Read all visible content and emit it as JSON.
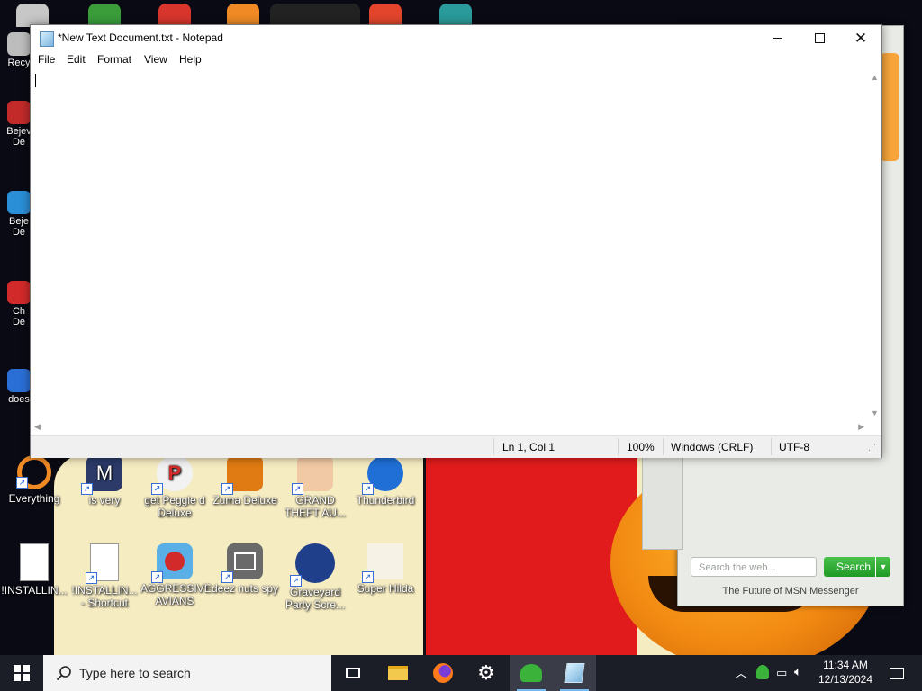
{
  "notepad": {
    "title": "*New Text Document.txt - Notepad",
    "menu": [
      "File",
      "Edit",
      "Format",
      "View",
      "Help"
    ],
    "content": "",
    "status": {
      "position": "Ln 1, Col 1",
      "zoom": "100%",
      "line_ending": "Windows (CRLF)",
      "encoding": "UTF-8"
    }
  },
  "desktop": {
    "left_icons": [
      "Recy",
      "Bejev De",
      "Beje De",
      "Ch De",
      "does"
    ],
    "icons_row1": [
      {
        "label": "Everything",
        "icon": "everything-icon"
      },
      {
        "label": "is very",
        "icon": "shield-icon"
      },
      {
        "label": "get Peggle d Deluxe",
        "icon": "peggle-icon"
      },
      {
        "label": "Zuma Deluxe",
        "icon": "zuma-icon"
      },
      {
        "label": "GRAND THEFT AU...",
        "icon": "anime-girl-icon"
      },
      {
        "label": "Thunderbird",
        "icon": "thunderbird-icon"
      }
    ],
    "icons_row2": [
      {
        "label": "!INSTALLIN...",
        "icon": "text-file-icon"
      },
      {
        "label": "!INSTALLIN... - Shortcut",
        "icon": "text-file-icon"
      },
      {
        "label": "AGGRESSIVE AVIANS",
        "icon": "angry-bird-icon"
      },
      {
        "label": "deez nuts spy",
        "icon": "windows-stack-icon"
      },
      {
        "label": "Graveyard Party Scre...",
        "icon": "voted-badge-icon"
      },
      {
        "label": "Super Hilda",
        "icon": "pixel-character-icon"
      }
    ]
  },
  "msn": {
    "search_placeholder": "Search the web...",
    "search_button": "Search",
    "footer": "The Future of MSN Messenger"
  },
  "taskbar": {
    "search_placeholder": "Type here to search",
    "apps": [
      "task-view-icon",
      "file-explorer-icon",
      "firefox-icon",
      "settings-icon",
      "msn-messenger-icon",
      "notepad-icon"
    ],
    "time": "11:34 AM",
    "date": "12/13/2024"
  },
  "colors": {
    "taskbar": "#1c1e27",
    "msn_search_button": "#2aa830",
    "wallpaper_red": "#e11b1b",
    "wallpaper_cream": "#f6ecc2",
    "pumpkin": "#f28a12"
  }
}
